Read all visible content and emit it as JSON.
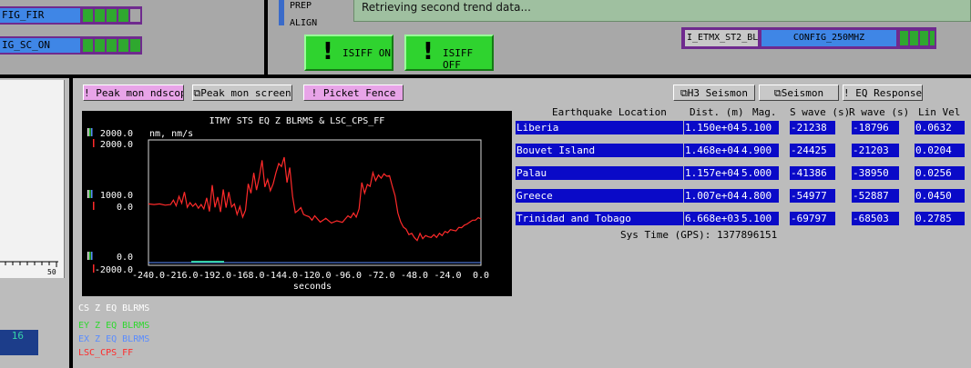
{
  "top_left": {
    "rows": [
      {
        "label": "FIG_FIR",
        "leds": [
          "on",
          "on",
          "on",
          "on",
          "off"
        ]
      },
      {
        "label": "IG_SC_ON",
        "leds": [
          "on",
          "on",
          "on",
          "on",
          "on"
        ]
      }
    ]
  },
  "top_mid": {
    "prep_label": "PREP",
    "align_label": "ALIGN",
    "buttons": [
      {
        "bang": "!",
        "label": "ISIFF ON"
      },
      {
        "bang": "!",
        "label": "ISIFF OFF"
      }
    ]
  },
  "banner": {
    "message": "Retrieving second trend data..."
  },
  "config_box": {
    "name": "I_ETMX_ST2_BL",
    "value": "CONFIG_250MHZ",
    "leds": [
      "on",
      "on",
      "on",
      "on",
      "off"
    ]
  },
  "left_panel": {
    "ruler_end": "50",
    "badge": "16"
  },
  "toolbar": {
    "peak_ndscope": "! Peak mon ndscope",
    "peak_screen": "⧉Peak mon screen",
    "picket_fence": "! Picket Fence",
    "h3_seismon": "⧉H3 Seismon",
    "seismon": "⧉Seismon",
    "eq_response": "! EQ Response"
  },
  "legend": {
    "items": [
      {
        "label": "CS Z EQ BLRMS",
        "color": "#ffffff"
      },
      {
        "label": "EY Z EQ BLRMS",
        "color": "#2ed82e"
      },
      {
        "label": "EX Z EQ BLRMS",
        "color": "#5a8cff"
      },
      {
        "label": "LSC_CPS_FF",
        "color": "#ff2a2a"
      }
    ]
  },
  "chart_data": {
    "type": "line",
    "title": "ITMY STS EQ Z BLRMS & LSC_CPS_FF",
    "units_label": "nm, nm/s",
    "xlabel": "seconds",
    "xlim": [
      -240,
      0
    ],
    "x_ticks": [
      "-240.0",
      "-216.0",
      "-192.0",
      "-168.0",
      "-144.0",
      "-120.0",
      "-96.0",
      "-72.0",
      "-48.0",
      "-24.0",
      "0.0"
    ],
    "y_left_ticks": [
      "2000.0",
      "1000.0",
      "0.0"
    ],
    "y_red_ticks": [
      "2000.0",
      "0.0",
      "-2000.0"
    ],
    "ylim": [
      -2000,
      2000
    ],
    "series": [
      {
        "name": "LSC_CPS_FF",
        "color": "#ff2a2a",
        "x": [
          -240,
          -236,
          -232,
          -228,
          -224,
          -222,
          -220,
          -218,
          -216,
          -214,
          -212,
          -210,
          -208,
          -206,
          -204,
          -202,
          -200,
          -198,
          -196,
          -194,
          -192,
          -190,
          -188,
          -186,
          -184,
          -182,
          -180,
          -178,
          -176,
          -174,
          -172,
          -170,
          -168,
          -166,
          -164,
          -162,
          -160,
          -158,
          -156,
          -154,
          -152,
          -150,
          -148,
          -146,
          -144,
          -142,
          -140,
          -138,
          -136,
          -134,
          -132,
          -130,
          -128,
          -126,
          -124,
          -122,
          -120,
          -116,
          -112,
          -108,
          -104,
          -100,
          -96,
          -94,
          -92,
          -90,
          -88,
          -86,
          -84,
          -82,
          -80,
          -78,
          -76,
          -74,
          -72,
          -70,
          -68,
          -66,
          -64,
          -62,
          -60,
          -58,
          -56,
          -54,
          -52,
          -50,
          -48,
          -46,
          -44,
          -42,
          -40,
          -38,
          -36,
          -34,
          -32,
          -30,
          -28,
          -26,
          -24,
          -22,
          -20,
          -18,
          -16,
          -14,
          -12,
          -10,
          -8,
          -6,
          -4,
          -2,
          0
        ],
        "y": [
          -40,
          -60,
          -40,
          -80,
          -60,
          80,
          -100,
          200,
          -20,
          340,
          -150,
          0,
          -120,
          -30,
          -180,
          -60,
          -200,
          150,
          -280,
          560,
          -150,
          180,
          -300,
          420,
          -160,
          340,
          -140,
          -40,
          -380,
          -120,
          -460,
          -240,
          600,
          300,
          950,
          400,
          820,
          1350,
          500,
          740,
          380,
          600,
          950,
          1250,
          1150,
          1450,
          640,
          1120,
          200,
          -320,
          -250,
          -160,
          -380,
          -420,
          -450,
          -560,
          -420,
          -620,
          -500,
          -650,
          -580,
          -630,
          -420,
          -480,
          -330,
          -460,
          -200,
          640,
          300,
          580,
          520,
          960,
          700,
          880,
          780,
          920,
          840,
          860,
          520,
          220,
          -330,
          -610,
          -780,
          -850,
          -1020,
          -980,
          -1120,
          -1210,
          -980,
          -1150,
          -1050,
          -1090,
          -1110,
          -1020,
          -1110,
          -980,
          -1050,
          -920,
          -960,
          -860,
          -880,
          -900,
          -790,
          -800,
          -720,
          -680,
          -620,
          -560,
          -560,
          -480,
          -520
        ]
      }
    ],
    "grid": false
  },
  "table": {
    "headers": [
      "Earthquake Location",
      "Dist. (m)",
      "Mag.",
      "S wave (s)",
      "R wave (s)",
      "Lin Vel"
    ],
    "rows": [
      [
        "Liberia",
        "1.150e+04",
        "5.100",
        "-21238",
        "-18796",
        "0.0632"
      ],
      [
        "Bouvet Island",
        "1.468e+04",
        "4.900",
        "-24425",
        "-21203",
        "0.0204"
      ],
      [
        "Palau",
        "1.157e+04",
        "5.000",
        "-41386",
        "-38950",
        "0.0256"
      ],
      [
        "Greece",
        "1.007e+04",
        "4.800",
        "-54977",
        "-52887",
        "0.0450"
      ],
      [
        "Trinidad and Tobago",
        "6.668e+03",
        "5.100",
        "-69797",
        "-68503",
        "0.2785"
      ]
    ],
    "sys_time": "Sys Time (GPS): 1377896151"
  }
}
